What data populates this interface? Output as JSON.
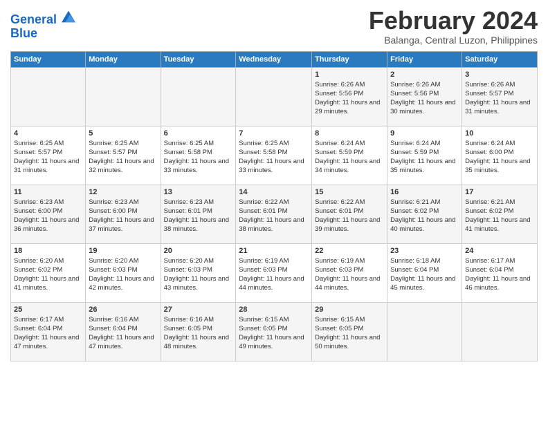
{
  "header": {
    "logo_line1": "General",
    "logo_line2": "Blue",
    "main_title": "February 2024",
    "sub_title": "Balanga, Central Luzon, Philippines"
  },
  "days_of_week": [
    "Sunday",
    "Monday",
    "Tuesday",
    "Wednesday",
    "Thursday",
    "Friday",
    "Saturday"
  ],
  "weeks": [
    [
      {
        "day": "",
        "sunrise": "",
        "sunset": "",
        "daylight": ""
      },
      {
        "day": "",
        "sunrise": "",
        "sunset": "",
        "daylight": ""
      },
      {
        "day": "",
        "sunrise": "",
        "sunset": "",
        "daylight": ""
      },
      {
        "day": "",
        "sunrise": "",
        "sunset": "",
        "daylight": ""
      },
      {
        "day": "1",
        "sunrise": "Sunrise: 6:26 AM",
        "sunset": "Sunset: 5:56 PM",
        "daylight": "Daylight: 11 hours and 29 minutes."
      },
      {
        "day": "2",
        "sunrise": "Sunrise: 6:26 AM",
        "sunset": "Sunset: 5:56 PM",
        "daylight": "Daylight: 11 hours and 30 minutes."
      },
      {
        "day": "3",
        "sunrise": "Sunrise: 6:26 AM",
        "sunset": "Sunset: 5:57 PM",
        "daylight": "Daylight: 11 hours and 31 minutes."
      }
    ],
    [
      {
        "day": "4",
        "sunrise": "Sunrise: 6:25 AM",
        "sunset": "Sunset: 5:57 PM",
        "daylight": "Daylight: 11 hours and 31 minutes."
      },
      {
        "day": "5",
        "sunrise": "Sunrise: 6:25 AM",
        "sunset": "Sunset: 5:57 PM",
        "daylight": "Daylight: 11 hours and 32 minutes."
      },
      {
        "day": "6",
        "sunrise": "Sunrise: 6:25 AM",
        "sunset": "Sunset: 5:58 PM",
        "daylight": "Daylight: 11 hours and 33 minutes."
      },
      {
        "day": "7",
        "sunrise": "Sunrise: 6:25 AM",
        "sunset": "Sunset: 5:58 PM",
        "daylight": "Daylight: 11 hours and 33 minutes."
      },
      {
        "day": "8",
        "sunrise": "Sunrise: 6:24 AM",
        "sunset": "Sunset: 5:59 PM",
        "daylight": "Daylight: 11 hours and 34 minutes."
      },
      {
        "day": "9",
        "sunrise": "Sunrise: 6:24 AM",
        "sunset": "Sunset: 5:59 PM",
        "daylight": "Daylight: 11 hours and 35 minutes."
      },
      {
        "day": "10",
        "sunrise": "Sunrise: 6:24 AM",
        "sunset": "Sunset: 6:00 PM",
        "daylight": "Daylight: 11 hours and 35 minutes."
      }
    ],
    [
      {
        "day": "11",
        "sunrise": "Sunrise: 6:23 AM",
        "sunset": "Sunset: 6:00 PM",
        "daylight": "Daylight: 11 hours and 36 minutes."
      },
      {
        "day": "12",
        "sunrise": "Sunrise: 6:23 AM",
        "sunset": "Sunset: 6:00 PM",
        "daylight": "Daylight: 11 hours and 37 minutes."
      },
      {
        "day": "13",
        "sunrise": "Sunrise: 6:23 AM",
        "sunset": "Sunset: 6:01 PM",
        "daylight": "Daylight: 11 hours and 38 minutes."
      },
      {
        "day": "14",
        "sunrise": "Sunrise: 6:22 AM",
        "sunset": "Sunset: 6:01 PM",
        "daylight": "Daylight: 11 hours and 38 minutes."
      },
      {
        "day": "15",
        "sunrise": "Sunrise: 6:22 AM",
        "sunset": "Sunset: 6:01 PM",
        "daylight": "Daylight: 11 hours and 39 minutes."
      },
      {
        "day": "16",
        "sunrise": "Sunrise: 6:21 AM",
        "sunset": "Sunset: 6:02 PM",
        "daylight": "Daylight: 11 hours and 40 minutes."
      },
      {
        "day": "17",
        "sunrise": "Sunrise: 6:21 AM",
        "sunset": "Sunset: 6:02 PM",
        "daylight": "Daylight: 11 hours and 41 minutes."
      }
    ],
    [
      {
        "day": "18",
        "sunrise": "Sunrise: 6:20 AM",
        "sunset": "Sunset: 6:02 PM",
        "daylight": "Daylight: 11 hours and 41 minutes."
      },
      {
        "day": "19",
        "sunrise": "Sunrise: 6:20 AM",
        "sunset": "Sunset: 6:03 PM",
        "daylight": "Daylight: 11 hours and 42 minutes."
      },
      {
        "day": "20",
        "sunrise": "Sunrise: 6:20 AM",
        "sunset": "Sunset: 6:03 PM",
        "daylight": "Daylight: 11 hours and 43 minutes."
      },
      {
        "day": "21",
        "sunrise": "Sunrise: 6:19 AM",
        "sunset": "Sunset: 6:03 PM",
        "daylight": "Daylight: 11 hours and 44 minutes."
      },
      {
        "day": "22",
        "sunrise": "Sunrise: 6:19 AM",
        "sunset": "Sunset: 6:03 PM",
        "daylight": "Daylight: 11 hours and 44 minutes."
      },
      {
        "day": "23",
        "sunrise": "Sunrise: 6:18 AM",
        "sunset": "Sunset: 6:04 PM",
        "daylight": "Daylight: 11 hours and 45 minutes."
      },
      {
        "day": "24",
        "sunrise": "Sunrise: 6:17 AM",
        "sunset": "Sunset: 6:04 PM",
        "daylight": "Daylight: 11 hours and 46 minutes."
      }
    ],
    [
      {
        "day": "25",
        "sunrise": "Sunrise: 6:17 AM",
        "sunset": "Sunset: 6:04 PM",
        "daylight": "Daylight: 11 hours and 47 minutes."
      },
      {
        "day": "26",
        "sunrise": "Sunrise: 6:16 AM",
        "sunset": "Sunset: 6:04 PM",
        "daylight": "Daylight: 11 hours and 47 minutes."
      },
      {
        "day": "27",
        "sunrise": "Sunrise: 6:16 AM",
        "sunset": "Sunset: 6:05 PM",
        "daylight": "Daylight: 11 hours and 48 minutes."
      },
      {
        "day": "28",
        "sunrise": "Sunrise: 6:15 AM",
        "sunset": "Sunset: 6:05 PM",
        "daylight": "Daylight: 11 hours and 49 minutes."
      },
      {
        "day": "29",
        "sunrise": "Sunrise: 6:15 AM",
        "sunset": "Sunset: 6:05 PM",
        "daylight": "Daylight: 11 hours and 50 minutes."
      },
      {
        "day": "",
        "sunrise": "",
        "sunset": "",
        "daylight": ""
      },
      {
        "day": "",
        "sunrise": "",
        "sunset": "",
        "daylight": ""
      }
    ]
  ]
}
